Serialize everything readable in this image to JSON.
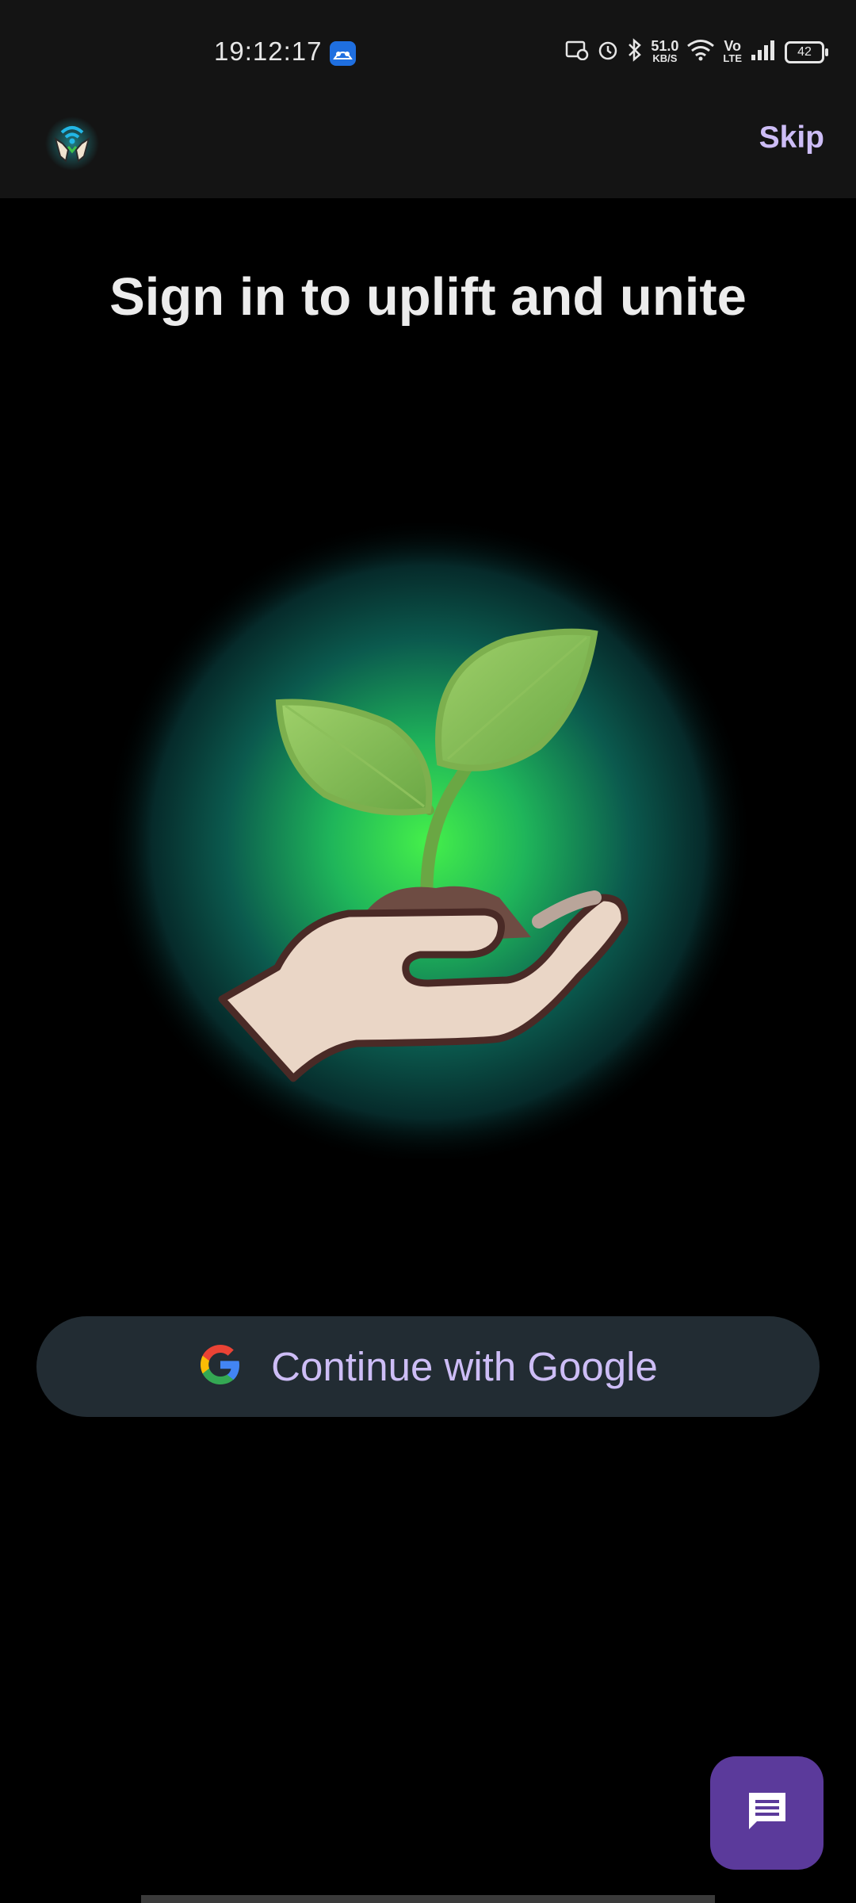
{
  "status_bar": {
    "time": "19:12:17",
    "speed_value": "51.0",
    "speed_unit": "KB/S",
    "lte_top": "Vo",
    "lte_bottom": "LTE",
    "battery": "42",
    "icons": [
      "android-app-icon",
      "screen-record-icon",
      "alarm-icon",
      "bluetooth-icon",
      "wifi-icon",
      "signal-icon",
      "battery-icon"
    ]
  },
  "app_bar": {
    "skip_label": "Skip",
    "logo_icon": "hands-wifi-logo"
  },
  "main": {
    "title": "Sign in to uplift and unite",
    "hero_icon": "hand-holding-sprout-illustration",
    "google_button_label": "Continue with Google",
    "fab_icon": "chat-icon"
  },
  "colors": {
    "accent": "#cdbdf6",
    "fab": "#5b3a9b",
    "button_bg": "#222c33",
    "glow_center": "#3fe24a",
    "glow_edge": "#0b3b3e"
  }
}
